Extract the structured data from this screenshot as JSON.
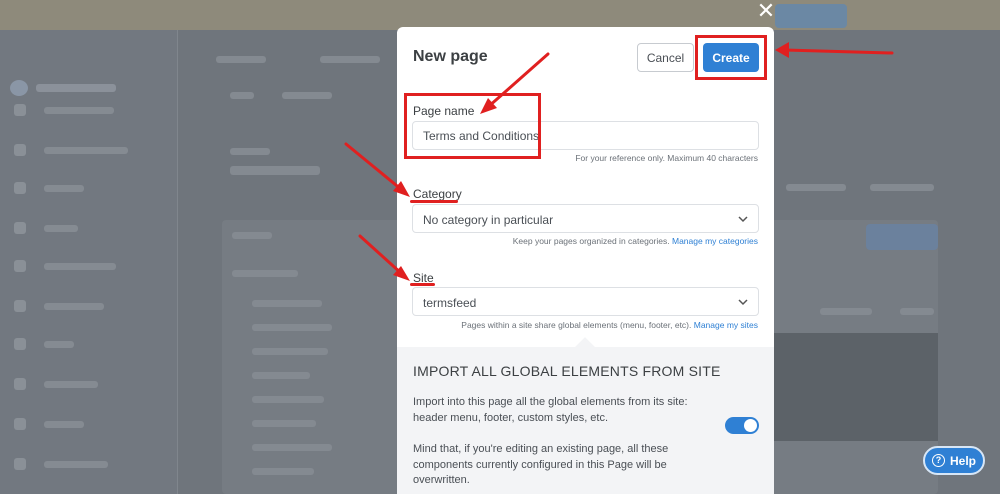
{
  "modal": {
    "title": "New page",
    "cancel_label": "Cancel",
    "create_label": "Create",
    "page_name": {
      "label": "Page name",
      "value": "Terms and Conditions",
      "hint": "For your reference only. Maximum 40 characters"
    },
    "category": {
      "label": "Category",
      "selected": "No category in particular",
      "hint": "Keep your pages organized in categories.",
      "hint_link": "Manage my categories"
    },
    "site": {
      "label": "Site",
      "selected": "termsfeed",
      "hint": "Pages within a site share global elements (menu, footer, etc).",
      "hint_link": "Manage my sites"
    },
    "import": {
      "title": "IMPORT ALL GLOBAL ELEMENTS FROM SITE",
      "description": "Import into this page all the global elements from its site: header menu, footer, custom styles, etc.",
      "note": "Mind that, if you're editing an existing page, all these components currently configured in this Page will be overwritten.",
      "toggle_on": true
    }
  },
  "close_glyph": "✕",
  "help": {
    "label": "Help",
    "icon": "question-circle-icon",
    "glyph": "?"
  },
  "colors": {
    "accent": "#2f80d4",
    "annotation": "#e02020",
    "overlay": "#7b8188"
  }
}
